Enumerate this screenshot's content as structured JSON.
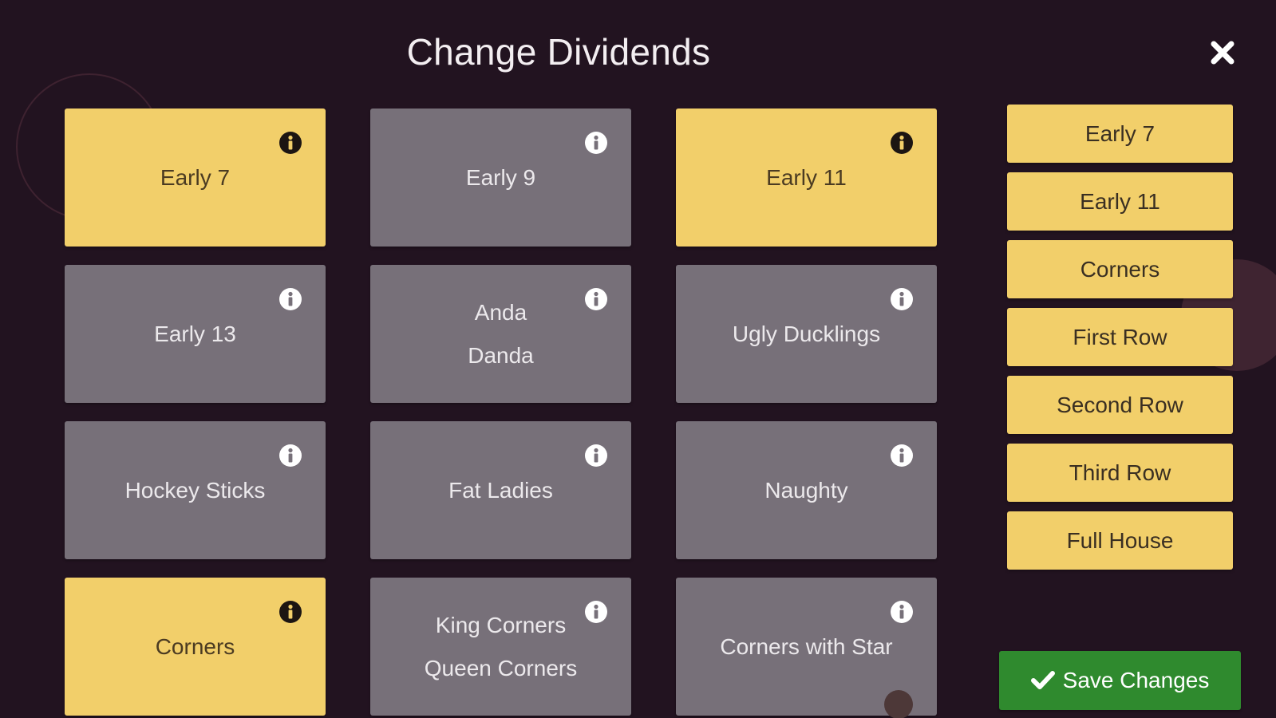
{
  "dialog": {
    "title": "Change Dividends",
    "close_icon": "close-icon"
  },
  "dividends": [
    {
      "label": "Early 7",
      "selected": true
    },
    {
      "label": "Early 9",
      "selected": false
    },
    {
      "label": "Early 11",
      "selected": true
    },
    {
      "label": "Early 13",
      "selected": false
    },
    {
      "label": "Anda\nDanda",
      "selected": false
    },
    {
      "label": "Ugly Ducklings",
      "selected": false
    },
    {
      "label": "Hockey Sticks",
      "selected": false
    },
    {
      "label": "Fat Ladies",
      "selected": false
    },
    {
      "label": "Naughty",
      "selected": false
    },
    {
      "label": "Corners",
      "selected": true
    },
    {
      "label": "King Corners\nQueen Corners",
      "selected": false
    },
    {
      "label": "Corners with Star",
      "selected": false
    }
  ],
  "selected_list": [
    "Early 7",
    "Early 11",
    "Corners",
    "First Row",
    "Second Row",
    "Third Row",
    "Full House"
  ],
  "save_button": {
    "label": "Save Changes",
    "icon": "check-icon"
  },
  "colors": {
    "background": "#221320",
    "selected_tile": "#f2cf6a",
    "unselected_tile": "#777079",
    "save_green": "#2f8a2e"
  }
}
